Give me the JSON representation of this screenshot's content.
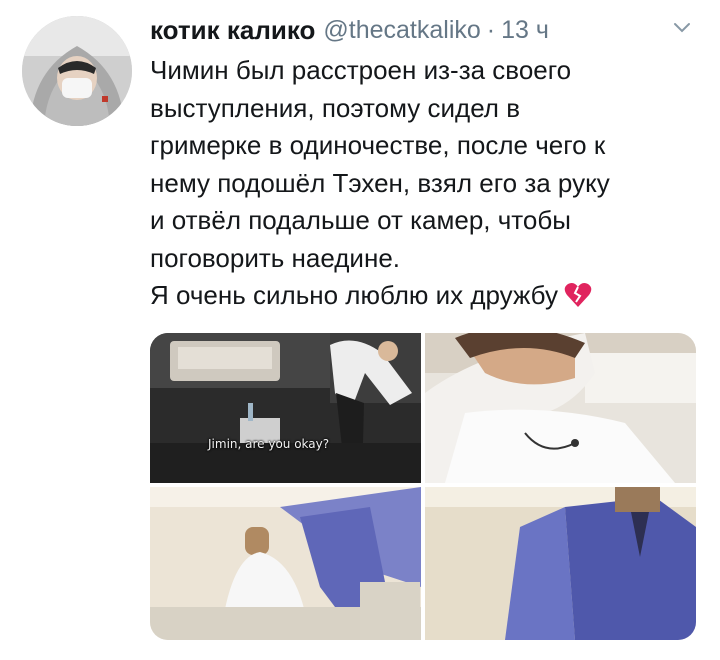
{
  "tweet": {
    "author_name": "котик калико",
    "handle": "@thecatkaliko",
    "separator": "·",
    "time": "13 ч",
    "caret_icon": "chevron-down-icon",
    "lines": [
      "Чимин был расстроен из-за своего",
      "выступления, поэтому сидел в",
      "гримерке в одиночестве, после чего к",
      "нему подошёл Тэхен, взял его за руку",
      "и отвёл подальше от камер, чтобы",
      "поговорить наедине.",
      "Я очень сильно люблю их дружбу"
    ],
    "emoji": "broken-heart-icon"
  },
  "media": {
    "subtitle": "Jimin, are you okay?"
  },
  "colors": {
    "text": "#14171a",
    "muted": "#657786",
    "heart": "#e0245e"
  }
}
